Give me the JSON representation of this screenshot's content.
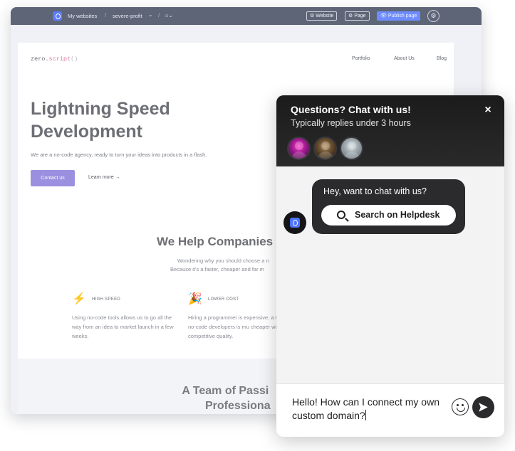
{
  "builder": {
    "topbar": {
      "my_websites": "My websites",
      "sep1": "/",
      "site_name": "severe-profit",
      "site_chevron": "⌄",
      "sep2": "/",
      "home": "⌂⌄",
      "website_btn": "⚙ Website",
      "page_btn": "⚙ Page",
      "publish_btn": "👁 Publish page",
      "gear_icon": "gear-icon"
    },
    "site": {
      "brand_prefix": "zero.",
      "brand_keyword": "script",
      "brand_parens": "()",
      "nav": [
        "Portfolio",
        "About Us",
        "Blog"
      ],
      "hero_title_line1": "Lightning Speed",
      "hero_title_line2": "Development",
      "hero_lead": "We are a no-code agency, ready to turn your ideas into products in a flash.",
      "cta_label": "Contact us",
      "learn_more": "Learn more →",
      "section_title": "We Help Companies",
      "section_sub1": "Wondering why you should choose a n",
      "section_sub2": "Because it's a faster, cheaper and far m",
      "features": [
        {
          "icon": "⚡",
          "title": "HIGH SPEED",
          "text": "Using no-code tools allows us to go all the way from an idea to market launch in a few weeks."
        },
        {
          "icon": "🎉",
          "title": "LOWER COST",
          "text": "Hiring a programmer is expensive. a team of no-code developers is mu cheaper with competitive quality."
        }
      ],
      "band_title_line1": "A Team of Passi",
      "band_title_line2": "Professiona"
    }
  },
  "chat": {
    "title": "Questions? Chat with us!",
    "subtitle": "Typically replies under 3 hours",
    "close_icon": "×",
    "bubble_text": "Hey, want to chat with us?",
    "helpdesk_button": "Search on Helpdesk",
    "composer_text_line1": "Hello! How can I connect my own",
    "composer_text_line2": "custom domain?"
  },
  "colors": {
    "accent": "#5b7cf7",
    "cta": "#9b8fe0",
    "chat_dark": "#2b2b2d"
  }
}
